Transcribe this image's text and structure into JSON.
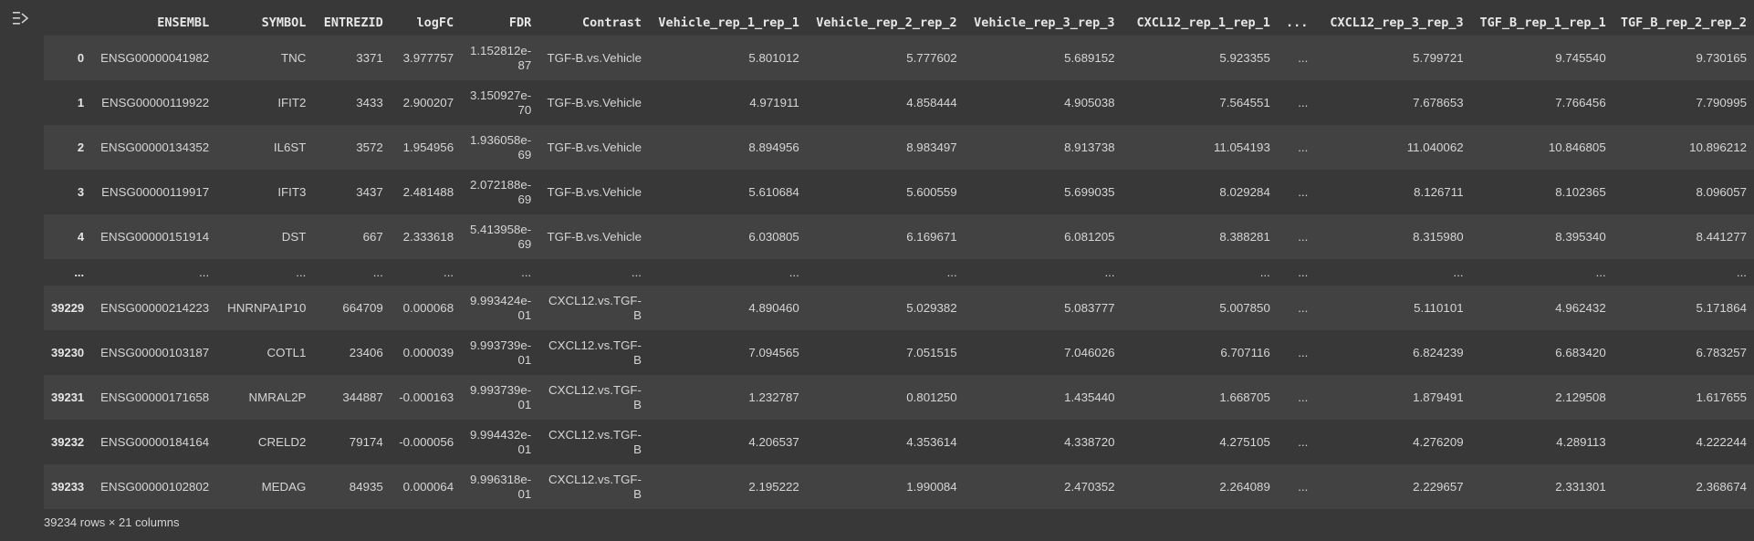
{
  "columns": [
    "",
    "ENSEMBL",
    "SYMBOL",
    "ENTREZID",
    "logFC",
    "FDR",
    "Contrast",
    "Vehicle_rep_1_rep_1",
    "Vehicle_rep_2_rep_2",
    "Vehicle_rep_3_rep_3",
    "CXCL12_rep_1_rep_1",
    "...",
    "CXCL12_rep_3_rep_3",
    "TGF_B_rep_1_rep_1",
    "TGF_B_rep_2_rep_2"
  ],
  "rows": [
    {
      "idx": "0",
      "ensembl": "ENSG00000041982",
      "symbol": "TNC",
      "entrez": "3371",
      "logfc": "3.977757",
      "fdr": "1.152812e-87",
      "contrast": "TGF-B.vs.Vehicle",
      "v1": "5.801012",
      "v2": "5.777602",
      "v3": "5.689152",
      "c1": "5.923355",
      "ell": "...",
      "c3": "5.799721",
      "t1": "9.745540",
      "t2": "9.730165"
    },
    {
      "idx": "1",
      "ensembl": "ENSG00000119922",
      "symbol": "IFIT2",
      "entrez": "3433",
      "logfc": "2.900207",
      "fdr": "3.150927e-70",
      "contrast": "TGF-B.vs.Vehicle",
      "v1": "4.971911",
      "v2": "4.858444",
      "v3": "4.905038",
      "c1": "7.564551",
      "ell": "...",
      "c3": "7.678653",
      "t1": "7.766456",
      "t2": "7.790995"
    },
    {
      "idx": "2",
      "ensembl": "ENSG00000134352",
      "symbol": "IL6ST",
      "entrez": "3572",
      "logfc": "1.954956",
      "fdr": "1.936058e-69",
      "contrast": "TGF-B.vs.Vehicle",
      "v1": "8.894956",
      "v2": "8.983497",
      "v3": "8.913738",
      "c1": "11.054193",
      "ell": "...",
      "c3": "11.040062",
      "t1": "10.846805",
      "t2": "10.896212"
    },
    {
      "idx": "3",
      "ensembl": "ENSG00000119917",
      "symbol": "IFIT3",
      "entrez": "3437",
      "logfc": "2.481488",
      "fdr": "2.072188e-69",
      "contrast": "TGF-B.vs.Vehicle",
      "v1": "5.610684",
      "v2": "5.600559",
      "v3": "5.699035",
      "c1": "8.029284",
      "ell": "...",
      "c3": "8.126711",
      "t1": "8.102365",
      "t2": "8.096057"
    },
    {
      "idx": "4",
      "ensembl": "ENSG00000151914",
      "symbol": "DST",
      "entrez": "667",
      "logfc": "2.333618",
      "fdr": "5.413958e-69",
      "contrast": "TGF-B.vs.Vehicle",
      "v1": "6.030805",
      "v2": "6.169671",
      "v3": "6.081205",
      "c1": "8.388281",
      "ell": "...",
      "c3": "8.315980",
      "t1": "8.395340",
      "t2": "8.441277"
    },
    {
      "idx": "...",
      "ensembl": "...",
      "symbol": "...",
      "entrez": "...",
      "logfc": "...",
      "fdr": "...",
      "contrast": "...",
      "v1": "...",
      "v2": "...",
      "v3": "...",
      "c1": "...",
      "ell": "...",
      "c3": "...",
      "t1": "...",
      "t2": "..."
    },
    {
      "idx": "39229",
      "ensembl": "ENSG00000214223",
      "symbol": "HNRNPA1P10",
      "entrez": "664709",
      "logfc": "0.000068",
      "fdr": "9.993424e-01",
      "contrast": "CXCL12.vs.TGF-B",
      "v1": "4.890460",
      "v2": "5.029382",
      "v3": "5.083777",
      "c1": "5.007850",
      "ell": "...",
      "c3": "5.110101",
      "t1": "4.962432",
      "t2": "5.171864"
    },
    {
      "idx": "39230",
      "ensembl": "ENSG00000103187",
      "symbol": "COTL1",
      "entrez": "23406",
      "logfc": "0.000039",
      "fdr": "9.993739e-01",
      "contrast": "CXCL12.vs.TGF-B",
      "v1": "7.094565",
      "v2": "7.051515",
      "v3": "7.046026",
      "c1": "6.707116",
      "ell": "...",
      "c3": "6.824239",
      "t1": "6.683420",
      "t2": "6.783257"
    },
    {
      "idx": "39231",
      "ensembl": "ENSG00000171658",
      "symbol": "NMRAL2P",
      "entrez": "344887",
      "logfc": "-0.000163",
      "fdr": "9.993739e-01",
      "contrast": "CXCL12.vs.TGF-B",
      "v1": "1.232787",
      "v2": "0.801250",
      "v3": "1.435440",
      "c1": "1.668705",
      "ell": "...",
      "c3": "1.879491",
      "t1": "2.129508",
      "t2": "1.617655"
    },
    {
      "idx": "39232",
      "ensembl": "ENSG00000184164",
      "symbol": "CRELD2",
      "entrez": "79174",
      "logfc": "-0.000056",
      "fdr": "9.994432e-01",
      "contrast": "CXCL12.vs.TGF-B",
      "v1": "4.206537",
      "v2": "4.353614",
      "v3": "4.338720",
      "c1": "4.275105",
      "ell": "...",
      "c3": "4.276209",
      "t1": "4.289113",
      "t2": "4.222244"
    },
    {
      "idx": "39233",
      "ensembl": "ENSG00000102802",
      "symbol": "MEDAG",
      "entrez": "84935",
      "logfc": "0.000064",
      "fdr": "9.996318e-01",
      "contrast": "CXCL12.vs.TGF-B",
      "v1": "2.195222",
      "v2": "1.990084",
      "v3": "2.470352",
      "c1": "2.264089",
      "ell": "...",
      "c3": "2.229657",
      "t1": "2.331301",
      "t2": "2.368674"
    }
  ],
  "caption": "39234 rows × 21 columns",
  "output_icon": "output-actions-icon",
  "colors": {
    "background": "#383838",
    "row_alt": "#424242",
    "text": "#d5d5d5"
  }
}
